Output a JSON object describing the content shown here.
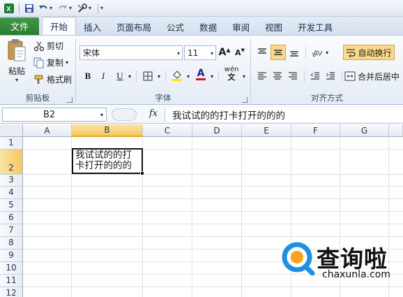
{
  "qat": {
    "icons": [
      "excel-logo-icon",
      "save-icon",
      "undo-icon",
      "redo-icon",
      "customize-icon"
    ]
  },
  "tabs": {
    "file": "文件",
    "items": [
      "开始",
      "插入",
      "页面布局",
      "公式",
      "数据",
      "审阅",
      "视图",
      "开发工具"
    ],
    "active_index": 0
  },
  "ribbon": {
    "clipboard": {
      "paste": "粘贴",
      "cut": "剪切",
      "copy": "复制",
      "format_painter": "格式刷",
      "label": "剪贴板"
    },
    "font": {
      "font_name": "宋体",
      "font_size": "11",
      "label": "字体",
      "bold": "B",
      "italic": "I",
      "underline": "U",
      "grow": "A",
      "shrink": "A",
      "font_color": "A",
      "phonetic": "wén"
    },
    "alignment": {
      "wrap_text": "自动换行",
      "merge_center": "合并后居中",
      "label": "对齐方式"
    }
  },
  "formula_bar": {
    "name_box": "B2",
    "fx": "fx",
    "content": "我试试的的打卡打开的的的"
  },
  "sheet": {
    "columns": [
      "A",
      "B",
      "C",
      "D",
      "E",
      "F",
      "G"
    ],
    "rows": [
      "1",
      "2",
      "3",
      "4",
      "5",
      "6",
      "7",
      "8",
      "9",
      "10",
      "11",
      "12"
    ],
    "selected_column": "B",
    "selected_row": "2",
    "active_cell_text": "我试试的的打卡打开的的的"
  },
  "watermark": {
    "text": "查询啦",
    "url": "chaxunla.com"
  },
  "colors": {
    "file_tab": "#2b7c30",
    "selection_header": "#f5c961",
    "wrap_highlight": "#fbd98a",
    "watermark_blue": "#1f8fe0"
  }
}
